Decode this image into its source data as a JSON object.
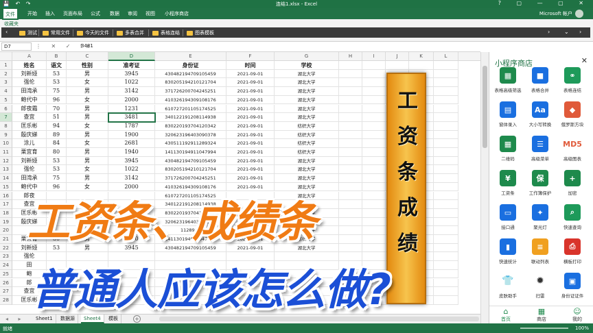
{
  "window": {
    "title": "连结1.xlsx - Excel",
    "qa_icons": "💾 ↶ ↷",
    "controls": "? ▢ — ▢ ✕"
  },
  "menu": {
    "tabs": [
      "文件",
      "开始",
      "插入",
      "页面布局",
      "公式",
      "数据",
      "审阅",
      "视图",
      "小程序商店"
    ],
    "account": "Microsoft 帐户"
  },
  "favorites": {
    "header": "收藏夹",
    "items": [
      "测试",
      "常用文件",
      "今天的文件",
      "多表合并",
      "表格连结",
      "图表模板"
    ]
  },
  "formula_bar": {
    "name_box": "D7",
    "icons": "⋮ ✕ ✓ fx",
    "value": "3481"
  },
  "columns": [
    "A",
    "B",
    "C",
    "D",
    "E",
    "F",
    "G",
    "H",
    "I",
    "J",
    "K",
    "L"
  ],
  "rows": [
    {
      "n": "1",
      "v": [
        "姓名",
        "语文",
        "性别",
        "准考证",
        "身份证",
        "时间",
        "学校"
      ]
    },
    {
      "n": "2",
      "v": [
        "刘新娅",
        "53",
        "男",
        "3945",
        "430482194709105459",
        "2021-09-01",
        "湖北大学"
      ]
    },
    {
      "n": "3",
      "v": [
        "强伦",
        "53",
        "女",
        "1022",
        "830205194210121704",
        "2021-09-01",
        "湖北大学"
      ]
    },
    {
      "n": "4",
      "v": [
        "田湾承",
        "75",
        "男",
        "3142",
        "371726200704245251",
        "2021-09-01",
        "湖北大学"
      ]
    },
    {
      "n": "5",
      "v": [
        "鲍代中",
        "96",
        "女",
        "2000",
        "410326194309108176",
        "2021-09-01",
        "湖北大学"
      ]
    },
    {
      "n": "6",
      "v": [
        "郎夜霜",
        "70",
        "男",
        "1231",
        "610727201105174525",
        "2021-09-01",
        "湖北大学"
      ]
    },
    {
      "n": "7",
      "v": [
        "查宜",
        "51",
        "男",
        "3481",
        "340122191208114938",
        "2021-09-01",
        "湖北大学"
      ]
    },
    {
      "n": "8",
      "v": [
        "匡乐彬",
        "94",
        "女",
        "1787",
        "830220193704120342",
        "2021-09-01",
        "纺织大学"
      ]
    },
    {
      "n": "9",
      "v": [
        "殷庆娣",
        "89",
        "男",
        "1900",
        "320623196403090378",
        "2021-09-01",
        "纺织大学"
      ]
    },
    {
      "n": "10",
      "v": [
        "涂儿",
        "84",
        "女",
        "2681",
        "430511192911289324",
        "2021-09-01",
        "纺织大学"
      ]
    },
    {
      "n": "11",
      "v": [
        "栗宜育",
        "80",
        "男",
        "1940",
        "141130194911047994",
        "2021-09-01",
        "纺织大学"
      ]
    },
    {
      "n": "12",
      "v": [
        "刘新娅",
        "53",
        "男",
        "3945",
        "430482194709105459",
        "2021-09-01",
        "湖北大学"
      ]
    },
    {
      "n": "13",
      "v": [
        "强伦",
        "53",
        "女",
        "1022",
        "830205194210121704",
        "2021-09-01",
        "湖北大学"
      ]
    },
    {
      "n": "14",
      "v": [
        "田湾承",
        "75",
        "男",
        "3142",
        "371726200704245251",
        "2021-09-01",
        "湖北大学"
      ]
    },
    {
      "n": "15",
      "v": [
        "鲍代中",
        "96",
        "女",
        "2000",
        "410326194309108176",
        "2021-09-01",
        "湖北大学"
      ]
    },
    {
      "n": "16",
      "v": [
        "郎夜",
        "",
        "",
        "",
        "610727201105174525",
        "",
        "湖北大学"
      ]
    },
    {
      "n": "17",
      "v": [
        "查宜",
        "",
        "",
        "",
        "340122191208114938",
        "",
        "湖北大学"
      ]
    },
    {
      "n": "18",
      "v": [
        "匡乐彬",
        "",
        "",
        "",
        "830220193704120342",
        "",
        "纺织大学"
      ]
    },
    {
      "n": "19",
      "v": [
        "殷庆娣",
        "",
        "",
        "",
        "320623196403090378",
        "",
        "纺织大学"
      ]
    },
    {
      "n": "20",
      "v": [
        "",
        "",
        "",
        "",
        "1128927",
        "",
        "纺织大学"
      ]
    },
    {
      "n": "21",
      "v": [
        "栗宜育",
        "80",
        "男",
        "1940",
        "141130194911047994",
        "2021-09-01",
        "纺织大学"
      ]
    },
    {
      "n": "22",
      "v": [
        "刘新娅",
        "53",
        "男",
        "3945",
        "430482194709105459",
        "2021-09-01",
        "湖北大学"
      ]
    },
    {
      "n": "23",
      "v": [
        "强伦",
        "",
        "",
        "",
        "",
        "",
        ""
      ]
    },
    {
      "n": "24",
      "v": [
        "田",
        "",
        "",
        "",
        "",
        "",
        ""
      ]
    },
    {
      "n": "25",
      "v": [
        "鲍",
        "",
        "",
        "",
        "",
        "",
        ""
      ]
    },
    {
      "n": "26",
      "v": [
        "郎",
        "",
        "",
        "",
        "",
        "",
        ""
      ]
    },
    {
      "n": "27",
      "v": [
        "查宜",
        "",
        "",
        "",
        "",
        "",
        ""
      ]
    },
    {
      "n": "28",
      "v": [
        "匡乐彬",
        "",
        "",
        "",
        "",
        "",
        ""
      ]
    }
  ],
  "sheets": [
    "Sheet1",
    "数据源",
    "Sheet4",
    "模板"
  ],
  "active_sheet": "Sheet4",
  "status": {
    "ready": "就绪",
    "zoom": "100%"
  },
  "panel": {
    "title": "小程序商店",
    "tools": [
      {
        "label": "表格高级筛选",
        "icon": "filter-table-icon",
        "color": "#1e8a4c"
      },
      {
        "label": "表格合并",
        "icon": "merge-icon",
        "color": "#1a6fe0"
      },
      {
        "label": "表格连结",
        "icon": "link-icon",
        "color": "#1e9a5a"
      },
      {
        "label": "窗体录入",
        "icon": "form-entry-icon",
        "color": "#1a6fe0"
      },
      {
        "label": "大小写转换",
        "icon": "case-convert-icon",
        "color": "#1a6fe0"
      },
      {
        "label": "俄罗斯方块",
        "icon": "cube-icon",
        "color": "#e05a3a"
      },
      {
        "label": "二维码",
        "icon": "qrcode-icon",
        "color": "#1e8a4c"
      },
      {
        "label": "高级菜单",
        "icon": "menu-icon",
        "color": "#1a6fe0"
      },
      {
        "label": "高级图表",
        "icon": "md5-icon",
        "color": "#e05a3a"
      },
      {
        "label": "工资条",
        "icon": "payslip-icon",
        "color": "#1e8a4c"
      },
      {
        "label": "工作簿保护",
        "icon": "protect-icon",
        "color": "#1e8a4c"
      },
      {
        "label": "加密",
        "icon": "lock-icon",
        "color": "#1e8a4c"
      },
      {
        "label": "接口通",
        "icon": "monitor-icon",
        "color": "#1a6fe0"
      },
      {
        "label": "聚光灯",
        "icon": "spotlight-icon",
        "color": "#1a6fe0"
      },
      {
        "label": "快速查询",
        "icon": "search-icon",
        "color": "#1e9a5a"
      },
      {
        "label": "快速统计",
        "icon": "bar-chart-icon",
        "color": "#1a6fe0"
      },
      {
        "label": "联动列表",
        "icon": "list-icon",
        "color": "#f0a020"
      },
      {
        "label": "横板打印",
        "icon": "printer-icon",
        "color": "#d9342b"
      },
      {
        "label": "皮肤助手",
        "icon": "shirt-icon",
        "color": "#d9342b"
      },
      {
        "label": "扫雷",
        "icon": "mine-icon",
        "color": "#333333"
      },
      {
        "label": "身份证证件",
        "icon": "id-card-icon",
        "color": "#1a6fe0"
      }
    ],
    "nav": [
      "首页",
      "商店",
      "我的"
    ]
  },
  "overlay": {
    "banner_chars": [
      "工",
      "资",
      "条",
      "成",
      "绩"
    ],
    "headline1": "工资条、成绩条",
    "headline2": "普通人应该怎么做?"
  }
}
